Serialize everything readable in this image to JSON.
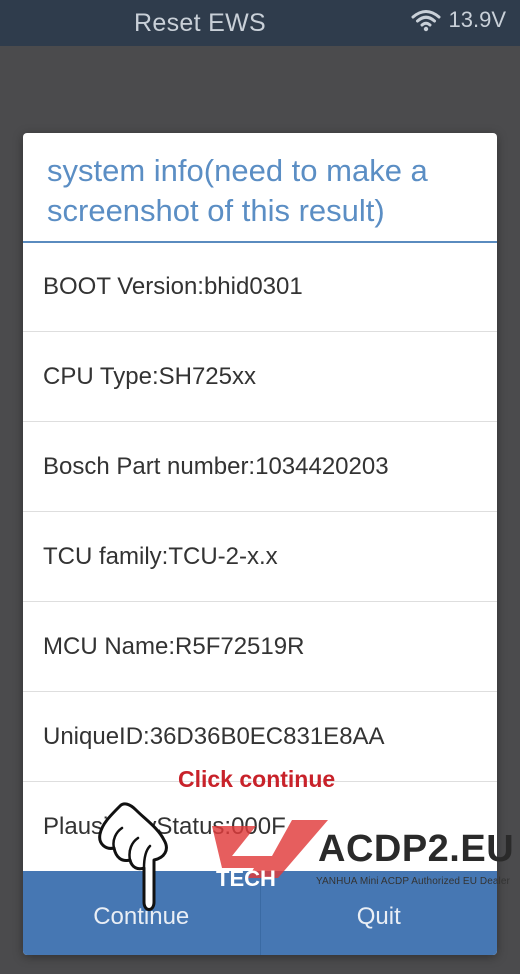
{
  "app": {
    "title": "Reset EWS",
    "voltage": "13.9V",
    "wifi_icon": "wifi-icon"
  },
  "dialog": {
    "title": "system info(need to make a screenshot of this result)",
    "rows": [
      "BOOT Version:bhid0301",
      "CPU Type:SH725xx",
      "Bosch Part number:1034420203",
      "TCU family:TCU-2-x.x",
      "MCU Name:R5F72519R",
      "UniqueID:36D36B0EC831E8AA",
      "PlausibilityStatus:000F"
    ],
    "buttons": {
      "continue": "Continue",
      "quit": "Quit"
    }
  },
  "annotation": {
    "text": "Click continue",
    "color": "#c8222a",
    "pointer_icon": "hand-pointer-icon"
  },
  "watermark": {
    "logo_text": "TECH",
    "site": "ACDP2.EU",
    "tagline": "YANHUA Mini ACDP Authorized EU Dealer",
    "color": "#e03a3a"
  },
  "colors": {
    "topbar": "#2f3c4c",
    "dialog_title": "#5b8ec4",
    "button_bar": "#4677b3"
  }
}
